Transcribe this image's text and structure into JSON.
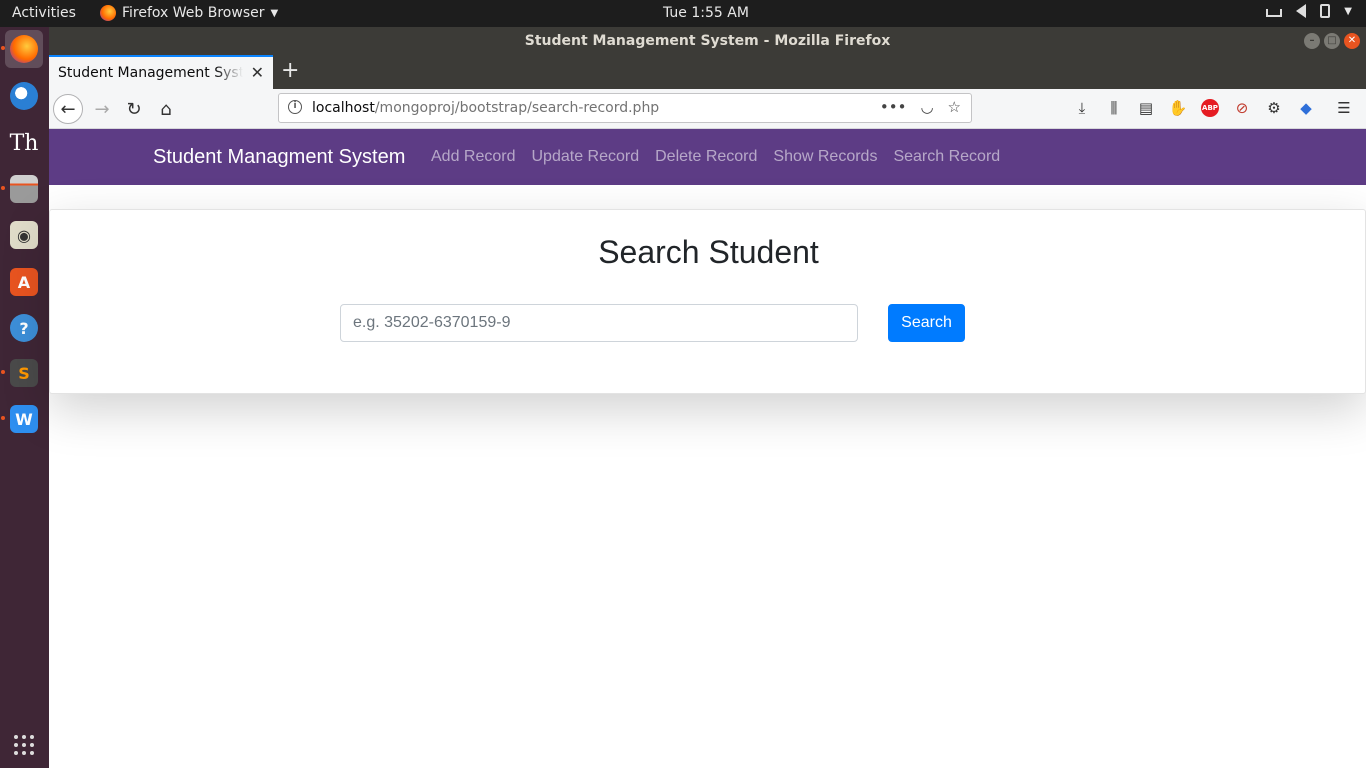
{
  "system": {
    "activities": "Activities",
    "app_menu": "Firefox Web Browser",
    "clock": "Tue  1:55 AM"
  },
  "window": {
    "title": "Student Management System - Mozilla Firefox"
  },
  "browser": {
    "tab_title": "Student Management System",
    "url_host": "localhost",
    "url_path": "/mongoproj/bootstrap/search-record.php"
  },
  "dock": {
    "items": [
      {
        "name": "firefox-icon",
        "color": "#ff7139"
      },
      {
        "name": "thunderbird-icon",
        "color": "#2a7fd4"
      },
      {
        "name": "typora-icon",
        "color": "#3f2636"
      },
      {
        "name": "files-icon",
        "color": "#d8d8d8"
      },
      {
        "name": "rhythmbox-icon",
        "color": "#e8c84a"
      },
      {
        "name": "software-center-icon",
        "color": "#e95420"
      },
      {
        "name": "help-icon",
        "color": "#3d8fd9"
      },
      {
        "name": "sublime-text-icon",
        "color": "#ff9800"
      },
      {
        "name": "wps-writer-icon",
        "color": "#2e8ff0"
      }
    ]
  },
  "app": {
    "brand": "Student Managment System",
    "nav": [
      "Add Record",
      "Update Record",
      "Delete Record",
      "Show Records",
      "Search Record"
    ],
    "navbar_color": "#5d3c85"
  },
  "search": {
    "title": "Search Student",
    "placeholder": "e.g. 35202-6370159-9",
    "button_label": "Search",
    "button_color": "#007bff"
  }
}
